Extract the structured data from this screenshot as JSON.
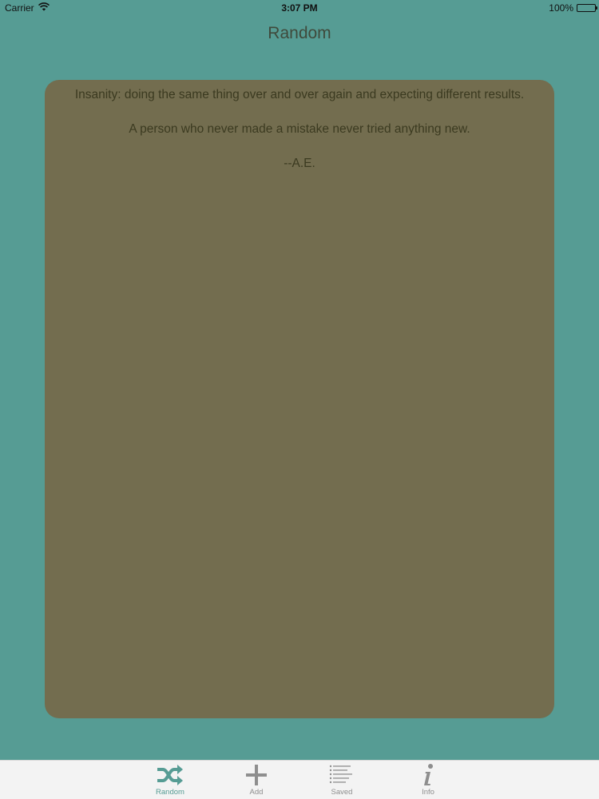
{
  "status_bar": {
    "carrier": "Carrier",
    "time": "3:07 PM",
    "battery": "100%",
    "battery_level": 1.0
  },
  "nav": {
    "title": "Random"
  },
  "quote": {
    "lines": [
      "Insanity: doing the same thing over and over again and expecting different results.",
      "A person who never made a mistake never tried anything new.",
      "--A.E."
    ]
  },
  "tab_bar": {
    "tabs": [
      {
        "label": "Random",
        "icon": "shuffle-icon",
        "active": true
      },
      {
        "label": "Add",
        "icon": "plus-icon",
        "active": false
      },
      {
        "label": "Saved",
        "icon": "list-icon",
        "active": false
      },
      {
        "label": "Info",
        "icon": "info-icon",
        "active": false
      }
    ]
  },
  "colors": {
    "background": "#569c94",
    "card": "#736d4f",
    "card_text": "#3b3a20",
    "tab_active": "#569c94",
    "tab_inactive": "#8e8e8e"
  }
}
